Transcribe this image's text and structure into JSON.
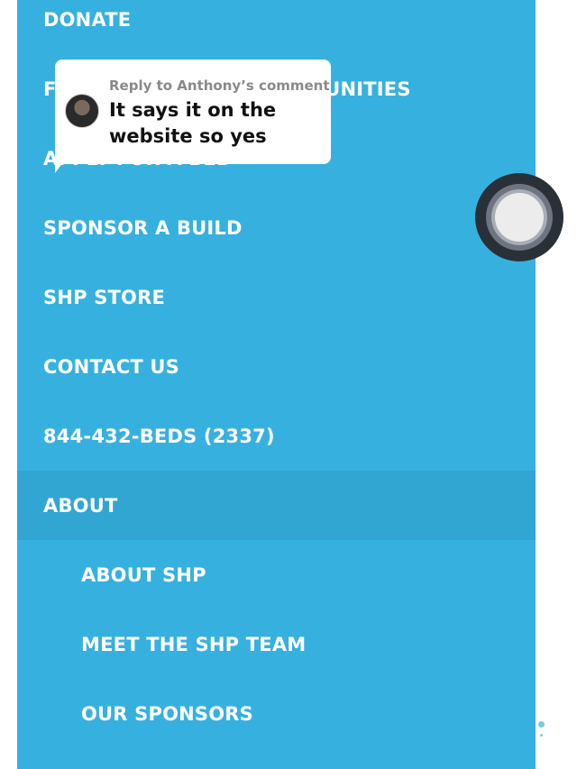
{
  "menu": {
    "donate": "DONATE",
    "volunteer": "FIND VOLUNTEER OPPORTUNITIES",
    "apply": "APPLY FOR A BED",
    "sponsor": "SPONSOR A BUILD",
    "store": "SHP STORE",
    "contact": "CONTACT US",
    "phone": "844-432-BEDS (2337)",
    "about": "ABOUT",
    "about_sub": [
      "ABOUT SHP",
      "MEET THE SHP TEAM",
      "OUR SPONSORS"
    ]
  },
  "comment": {
    "reply_to": "Reply to Anthony’s comment",
    "text": "It says it on the website so yes"
  },
  "colors": {
    "menu_background": "#36b1df",
    "active_row": "#31a6d2",
    "text": "#ffffff"
  },
  "icons": {
    "assistive_touch": "assistive-touch-icon",
    "avatar": "commenter-avatar"
  }
}
